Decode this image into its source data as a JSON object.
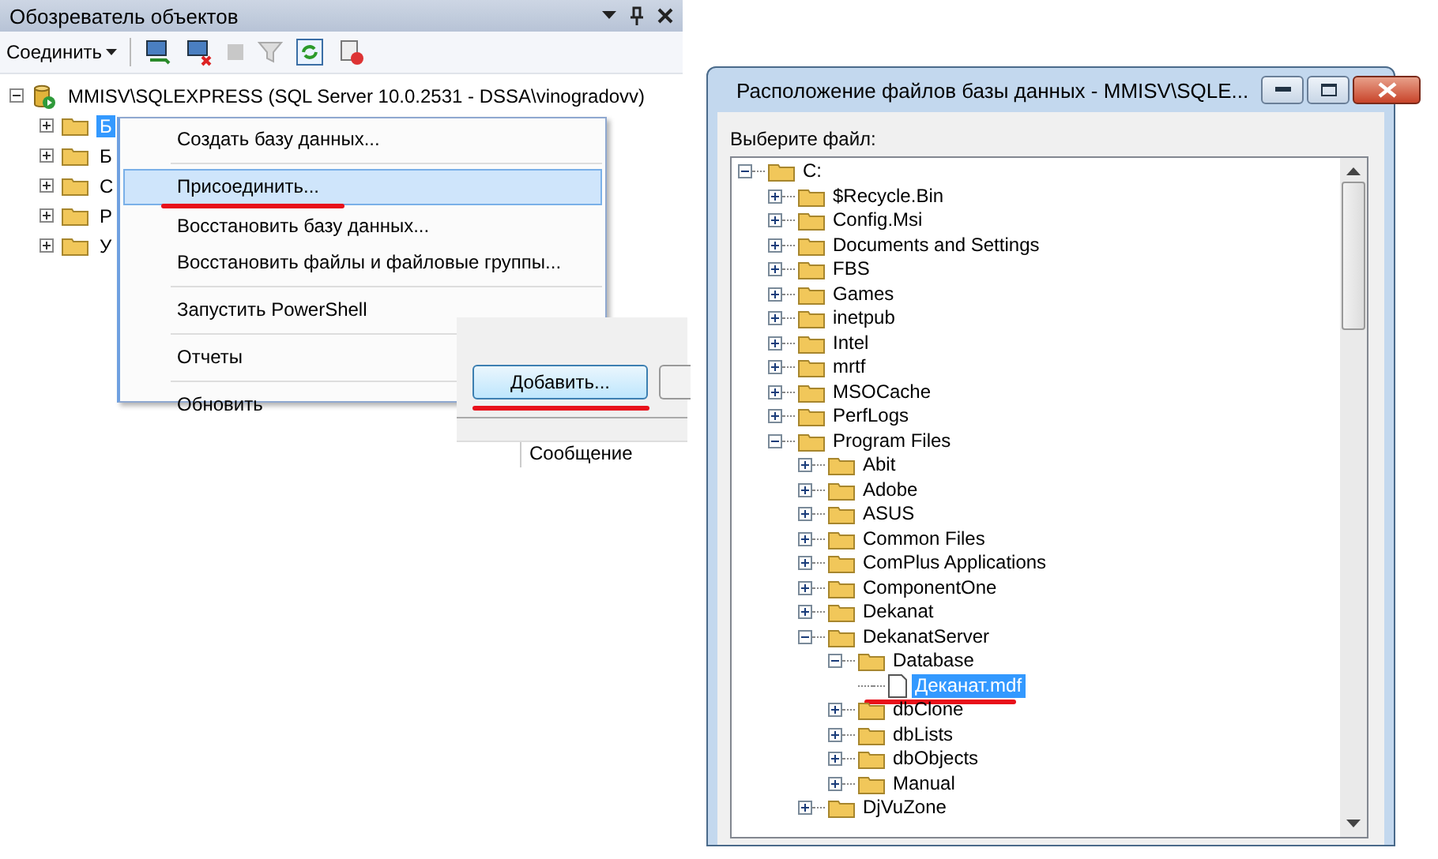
{
  "object_explorer": {
    "title": "Обозреватель объектов",
    "connect_button": "Соединить",
    "server": {
      "label": "MMISV\\SQLEXPRESS (SQL Server 10.0.2531 - DSSA\\vinogradovv)",
      "expanded": true,
      "children": [
        {
          "label": "Б",
          "expanded": false,
          "selected": true
        },
        {
          "label": "Б",
          "expanded": false,
          "selected": false
        },
        {
          "label": "С",
          "expanded": false,
          "selected": false
        },
        {
          "label": "Р",
          "expanded": false,
          "selected": false
        },
        {
          "label": "У",
          "expanded": false,
          "selected": false
        }
      ]
    }
  },
  "context_menu": {
    "items": [
      {
        "kind": "item",
        "label": "Создать базу данных...",
        "selected": false
      },
      {
        "kind": "separator"
      },
      {
        "kind": "item",
        "label": "Присоединить...",
        "selected": true,
        "underlined": true
      },
      {
        "kind": "item",
        "label": "Восстановить базу данных...",
        "selected": false
      },
      {
        "kind": "item",
        "label": "Восстановить файлы и файловые группы...",
        "selected": false
      },
      {
        "kind": "separator"
      },
      {
        "kind": "item",
        "label": "Запустить PowerShell",
        "selected": false
      },
      {
        "kind": "separator"
      },
      {
        "kind": "item",
        "label": "Отчеты",
        "selected": false
      },
      {
        "kind": "separator"
      },
      {
        "kind": "item",
        "label": "Обновить",
        "selected": false
      }
    ]
  },
  "attach_fragment": {
    "add_button": {
      "label": "Добавить...",
      "underlined": true
    },
    "column_header": "Сообщение"
  },
  "file_dialog": {
    "title": "Расположение файлов базы данных - MMISV\\SQLE...",
    "prompt": "Выберите файл:",
    "tree": [
      {
        "label": "C:",
        "kind": "folder",
        "expanded": true,
        "selected": false,
        "children": [
          {
            "label": "$Recycle.Bin",
            "kind": "folder",
            "expanded": false,
            "selected": false
          },
          {
            "label": "Config.Msi",
            "kind": "folder",
            "expanded": false,
            "selected": false
          },
          {
            "label": "Documents and Settings",
            "kind": "folder",
            "expanded": false,
            "selected": false
          },
          {
            "label": "FBS",
            "kind": "folder",
            "expanded": false,
            "selected": false
          },
          {
            "label": "Games",
            "kind": "folder",
            "expanded": false,
            "selected": false
          },
          {
            "label": "inetpub",
            "kind": "folder",
            "expanded": false,
            "selected": false
          },
          {
            "label": "Intel",
            "kind": "folder",
            "expanded": false,
            "selected": false
          },
          {
            "label": "mrtf",
            "kind": "folder",
            "expanded": false,
            "selected": false
          },
          {
            "label": "MSOCache",
            "kind": "folder",
            "expanded": false,
            "selected": false
          },
          {
            "label": "PerfLogs",
            "kind": "folder",
            "expanded": false,
            "selected": false
          },
          {
            "label": "Program Files",
            "kind": "folder",
            "expanded": true,
            "selected": false,
            "children": [
              {
                "label": "Abit",
                "kind": "folder",
                "expanded": false,
                "selected": false
              },
              {
                "label": "Adobe",
                "kind": "folder",
                "expanded": false,
                "selected": false
              },
              {
                "label": "ASUS",
                "kind": "folder",
                "expanded": false,
                "selected": false
              },
              {
                "label": "Common Files",
                "kind": "folder",
                "expanded": false,
                "selected": false
              },
              {
                "label": "ComPlus Applications",
                "kind": "folder",
                "expanded": false,
                "selected": false
              },
              {
                "label": "ComponentOne",
                "kind": "folder",
                "expanded": false,
                "selected": false
              },
              {
                "label": "Dekanat",
                "kind": "folder",
                "expanded": false,
                "selected": false
              },
              {
                "label": "DekanatServer",
                "kind": "folder",
                "expanded": true,
                "selected": false,
                "children": [
                  {
                    "label": "Database",
                    "kind": "folder",
                    "expanded": true,
                    "selected": false,
                    "children": [
                      {
                        "label": "Деканат.mdf",
                        "kind": "file",
                        "selected": true,
                        "underlined": true
                      }
                    ]
                  },
                  {
                    "label": "dbClone",
                    "kind": "folder",
                    "expanded": false,
                    "selected": false
                  },
                  {
                    "label": "dbLists",
                    "kind": "folder",
                    "expanded": false,
                    "selected": false
                  },
                  {
                    "label": "dbObjects",
                    "kind": "folder",
                    "expanded": false,
                    "selected": false
                  },
                  {
                    "label": "Manual",
                    "kind": "folder",
                    "expanded": false,
                    "selected": false
                  }
                ]
              },
              {
                "label": "DjVuZone",
                "kind": "folder",
                "expanded": false,
                "selected": false
              }
            ]
          }
        ]
      }
    ]
  }
}
